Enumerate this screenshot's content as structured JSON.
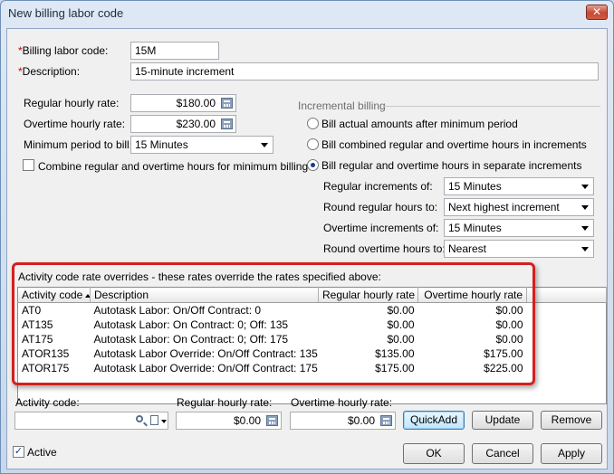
{
  "window": {
    "title": "New billing labor code",
    "close_glyph": "✕"
  },
  "form": {
    "billing_labor_code": {
      "label": "Billing labor code:",
      "required_mark": "*",
      "value": "15M"
    },
    "description": {
      "label": "Description:",
      "required_mark": "*",
      "value": "15-minute increment"
    },
    "regular_hourly_rate": {
      "label": "Regular hourly rate:",
      "value": "$180.00"
    },
    "overtime_hourly_rate": {
      "label": "Overtime hourly rate:",
      "value": "$230.00"
    },
    "minimum_period": {
      "label": "Minimum period to bill:",
      "value": "15  Minutes"
    },
    "combine_checkbox": {
      "label": "Combine regular and overtime hours for minimum billing",
      "checked": false
    }
  },
  "incremental": {
    "heading": "Incremental billing",
    "options": [
      {
        "label": "Bill actual amounts after minimum period",
        "selected": false
      },
      {
        "label": "Bill combined regular and overtime hours in increments",
        "selected": false
      },
      {
        "label": "Bill regular and overtime hours in separate increments",
        "selected": true
      }
    ],
    "regular_increments": {
      "label": "Regular increments of:",
      "value": "15  Minutes"
    },
    "round_regular": {
      "label": "Round regular hours to:",
      "value": "Next highest increment"
    },
    "overtime_increments": {
      "label": "Overtime increments of:",
      "value": "15  Minutes"
    },
    "round_overtime": {
      "label": "Round overtime hours to:",
      "value": "Nearest"
    }
  },
  "overrides": {
    "heading": "Activity code rate overrides - these rates override the rates specified above:",
    "columns": [
      "Activity code",
      "Description",
      "Regular hourly rate",
      "Overtime hourly rate"
    ],
    "rows": [
      [
        "AT0",
        "Autotask Labor: On/Off Contract: 0",
        "$0.00",
        "$0.00"
      ],
      [
        "AT135",
        "Autotask Labor: On Contract: 0; Off: 135",
        "$0.00",
        "$0.00"
      ],
      [
        "AT175",
        "Autotask Labor: On Contract: 0; Off: 175",
        "$0.00",
        "$0.00"
      ],
      [
        "ATOR135",
        "Autotask Labor Override: On/Off Contract: 135",
        "$135.00",
        "$175.00"
      ],
      [
        "ATOR175",
        "Autotask Labor Override: On/Off Contract: 175",
        "$175.00",
        "$225.00"
      ]
    ]
  },
  "editor": {
    "activity_code": {
      "label": "Activity code:",
      "value": ""
    },
    "regular_rate": {
      "label": "Regular hourly rate:",
      "value": "$0.00"
    },
    "overtime_rate": {
      "label": "Overtime hourly rate:",
      "value": "$0.00"
    },
    "quickadd_label": "QuickAdd",
    "update_label": "Update",
    "remove_label": "Remove"
  },
  "footer": {
    "active": {
      "label": "Active",
      "checked": true,
      "check_glyph": "✓"
    },
    "ok_label": "OK",
    "cancel_label": "Cancel",
    "apply_label": "Apply"
  },
  "colors": {
    "highlight_frame": "#d31f1f",
    "required": "#cc0000"
  }
}
